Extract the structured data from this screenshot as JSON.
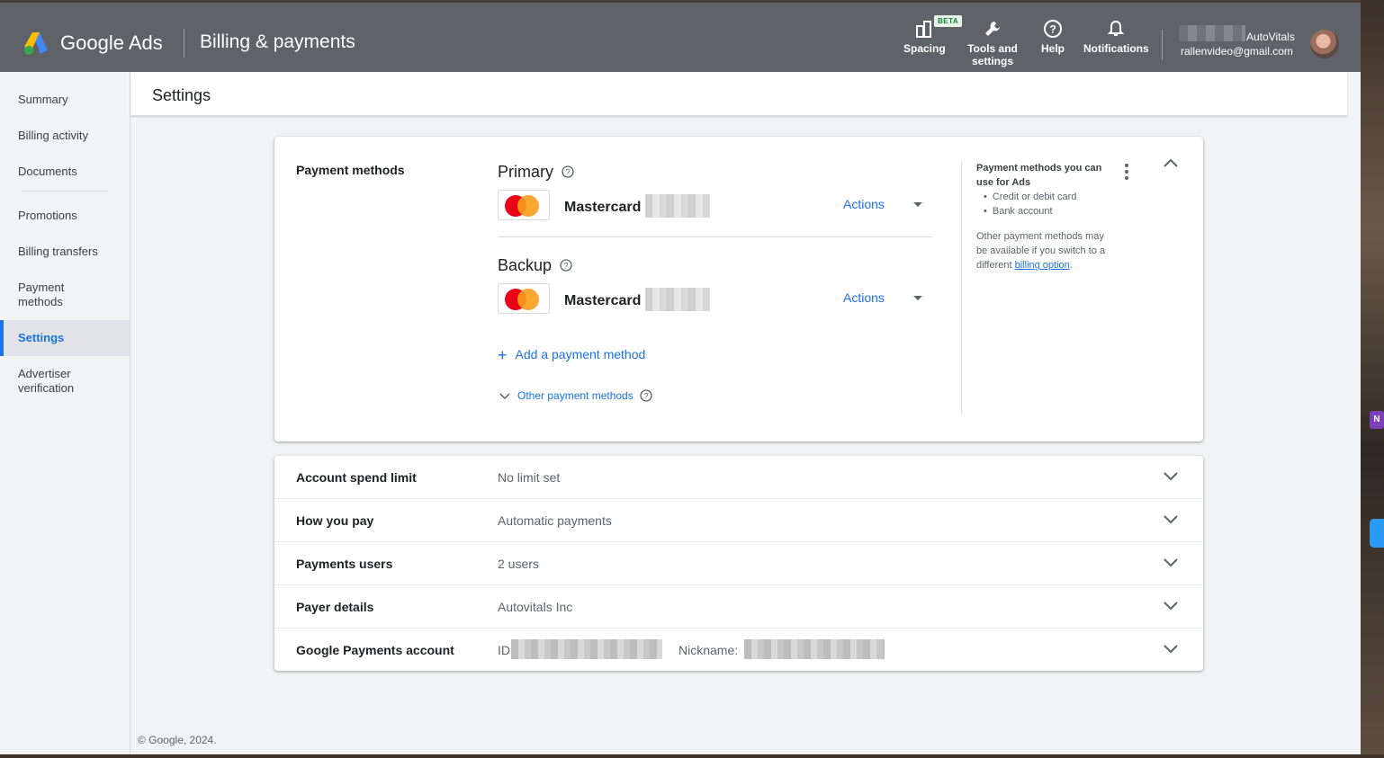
{
  "header": {
    "brand": "Google Ads",
    "page_name": "Billing & payments",
    "buttons": [
      {
        "label": "Spacing",
        "icon": "spacing-icon"
      },
      {
        "label": "Tools and settings",
        "icon": "wrench-icon"
      },
      {
        "label": "Help",
        "icon": "help-icon"
      },
      {
        "label": "Notifications",
        "icon": "bell-icon"
      }
    ],
    "beta_badge": "BETA",
    "account_name": "AutoVitals",
    "account_email": "rallenvideo@gmail.com"
  },
  "sidebar": {
    "items": [
      {
        "label": "Summary"
      },
      {
        "label": "Billing activity"
      },
      {
        "label": "Documents"
      },
      {
        "label": "Promotions"
      },
      {
        "label": "Billing transfers"
      },
      {
        "label": "Payment methods"
      },
      {
        "label": "Settings",
        "active": true
      },
      {
        "label": "Advertiser verification"
      }
    ]
  },
  "page_title": "Settings",
  "payment_methods": {
    "section_label": "Payment methods",
    "primary": {
      "title": "Primary",
      "card_name": "Mastercard",
      "actions_label": "Actions"
    },
    "backup": {
      "title": "Backup",
      "card_name": "Mastercard",
      "actions_label": "Actions"
    },
    "add_label": "Add a payment method",
    "other_label": "Other payment methods",
    "info": {
      "title": "Payment methods you can use for Ads",
      "options": [
        "Credit or debit card",
        "Bank account"
      ],
      "note": "Other payment methods may be available if you switch to a different",
      "link": "billing option",
      "note_end": "."
    }
  },
  "settings_rows": [
    {
      "label": "Account spend limit",
      "value": "No limit set"
    },
    {
      "label": "How you pay",
      "value": "Automatic payments"
    },
    {
      "label": "Payments users",
      "value": "2 users"
    },
    {
      "label": "Payer details",
      "value": "Autovitals Inc"
    },
    {
      "label": "Google Payments account",
      "value": "ID",
      "extra_label": "Nickname:"
    }
  ],
  "footer": "© Google, 2024.",
  "colors": {
    "header_bg": "#5f6368",
    "accent": "#1a73e8",
    "mastercard_red": "#eb001b",
    "mastercard_orange": "#f79e1b"
  }
}
